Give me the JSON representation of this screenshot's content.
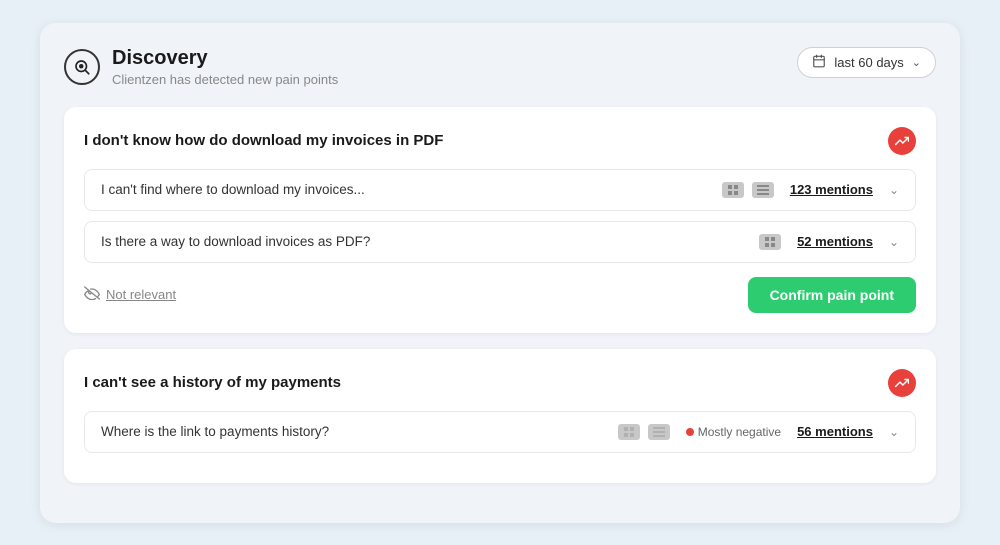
{
  "header": {
    "title": "Discovery",
    "subtitle": "Clientzen has detected new pain points",
    "date_filter_label": "last 60 days"
  },
  "cards": [
    {
      "id": "card1",
      "title": "I don't know how do download my invoices in PDF",
      "items": [
        {
          "text": "I can't find where to download my invoices...",
          "icons": [
            "grid-icon",
            "grid-icon-2"
          ],
          "mentions": "123 mentions"
        },
        {
          "text": "Is there a way to download invoices as PDF?",
          "icons": [
            "grid-icon"
          ],
          "mentions": "52 mentions"
        }
      ],
      "not_relevant_label": "Not relevant",
      "confirm_label": "Confirm pain point"
    },
    {
      "id": "card2",
      "title": "I can't see a history of my payments",
      "items": [
        {
          "text": "Where is the link to payments history?",
          "icons": [
            "grid-icon",
            "grid-icon-2"
          ],
          "sentiment": "Mostly negative",
          "mentions": "56 mentions"
        }
      ]
    }
  ]
}
